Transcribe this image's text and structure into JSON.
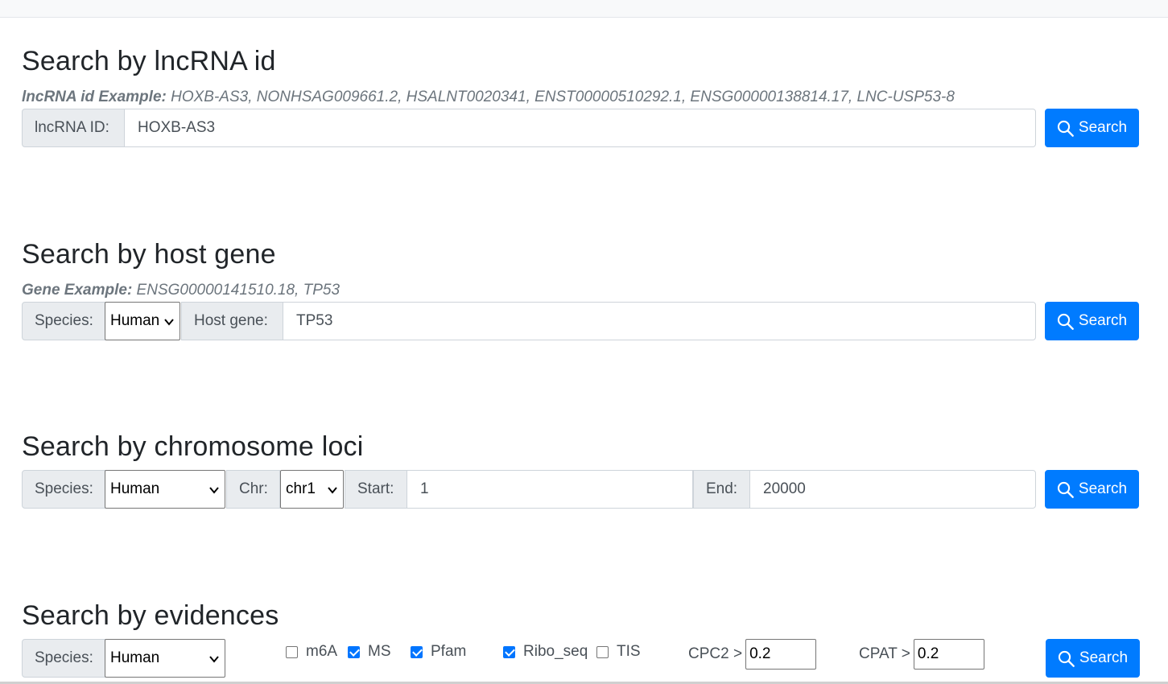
{
  "lncrna_section": {
    "title": "Search by lncRNA id",
    "example_label": "lncRNA id Example:",
    "example_values": " HOXB-AS3, NONHSAG009661.2, HSALNT0020341, ENST00000510292.1, ENSG00000138814.17, LNC-USP53-8",
    "id_label": "lncRNA ID:",
    "id_value": "HOXB-AS3",
    "search_label": "Search"
  },
  "host_section": {
    "title": "Search by host gene",
    "example_label": "Gene Example:",
    "example_values": " ENSG00000141510.18, TP53",
    "species_label": "Species:",
    "species_value": "Human",
    "gene_label": "Host gene:",
    "gene_value": "TP53",
    "search_label": "Search"
  },
  "loci_section": {
    "title": "Search by chromosome loci",
    "species_label": "Species:",
    "species_value": "Human",
    "chr_label": "Chr:",
    "chr_value": "chr1",
    "start_label": "Start:",
    "start_value": "1",
    "end_label": "End:",
    "end_value": "20000",
    "search_label": "Search"
  },
  "evidence_section": {
    "title": "Search by evidences",
    "species_label": "Species:",
    "species_value": "Human",
    "checkboxes": [
      {
        "label": "m6A",
        "checked": false
      },
      {
        "label": "MS",
        "checked": true
      },
      {
        "label": "Pfam",
        "checked": true
      },
      {
        "label": "Ribo_seq",
        "checked": true
      },
      {
        "label": "TIS",
        "checked": false
      }
    ],
    "cpc2_label": "CPC2 >",
    "cpc2_value": "0.2",
    "cpat_label": "CPAT >",
    "cpat_value": "0.2",
    "search_label": "Search"
  },
  "colors": {
    "primary": "#007bff",
    "addon_bg": "#e9ecef",
    "checkbox_on": "#0075ff"
  },
  "icons": {
    "search": "search-icon",
    "select_arrow": "chevron-down-icon"
  }
}
